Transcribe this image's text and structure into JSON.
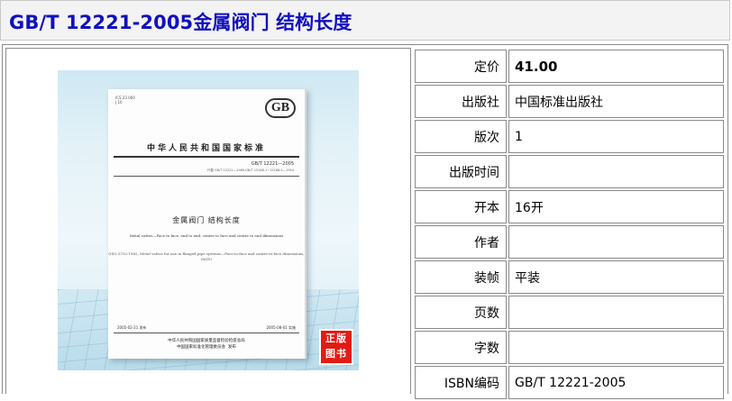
{
  "title": "GB/T 12221-2005金属阀门 结构长度",
  "cover": {
    "ics": "ICS 23.060\nJ 16",
    "logo": "GB",
    "standard_header": "中华人民共和国国家标准",
    "number": "GB/T 12221—2005",
    "replaces": "代替 GB/T 12221—1989,GB/T 15188.1~15188.4—1994",
    "title": "金属阀门  结构长度",
    "english_title": "Metal valves—Face to face, end to end, centre to face and centre to end dimensions",
    "iso_ref": "(ISO 5752:1982, Metal valves for use in flanged pipe systems—Face-to-face and centre-to-face dimensions, MOD)",
    "issue_date": "2005-02-21 发布",
    "effective_date": "2005-08-01 实施",
    "publisher": "中华人民共和国国家质量监督检验检疫总局\n中国国家标准化管理委员会  发布",
    "stamp_line1": "正版",
    "stamp_line2": "图书"
  },
  "info": {
    "rows": [
      {
        "label": "定价",
        "value": "41.00"
      },
      {
        "label": "出版社",
        "value": "中国标准出版社"
      },
      {
        "label": "版次",
        "value": "1"
      },
      {
        "label": "出版时间",
        "value": ""
      },
      {
        "label": "开本",
        "value": "16开"
      },
      {
        "label": "作者",
        "value": ""
      },
      {
        "label": "装帧",
        "value": "平装"
      },
      {
        "label": "页数",
        "value": ""
      },
      {
        "label": "字数",
        "value": ""
      },
      {
        "label": "ISBN编码",
        "value": "GB/T 12221-2005"
      }
    ]
  }
}
